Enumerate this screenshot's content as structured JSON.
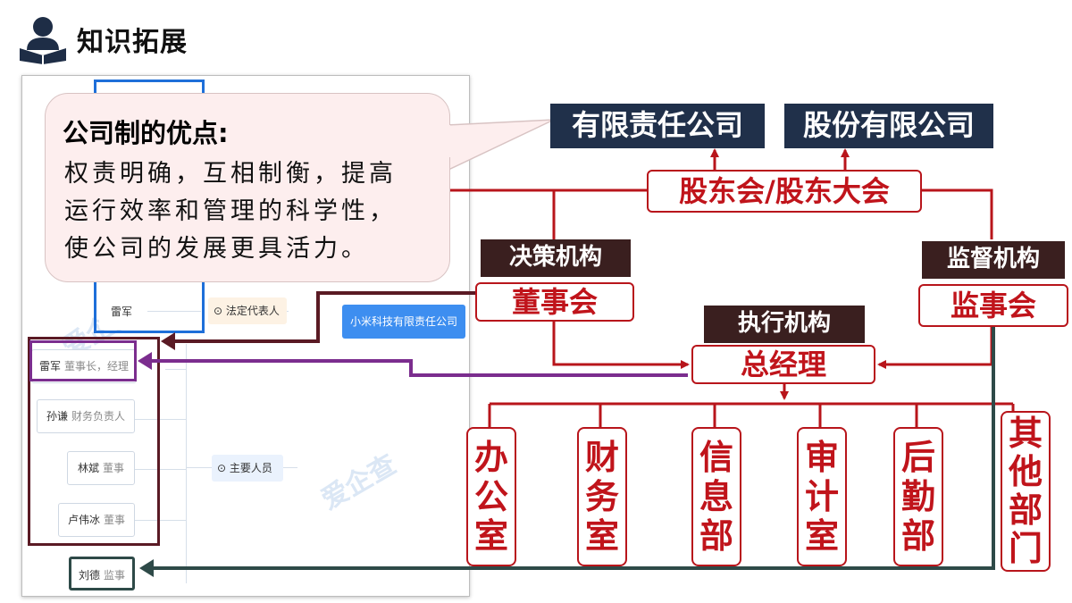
{
  "header": {
    "title": "知识拓展",
    "icon": "reader-book-icon"
  },
  "bubble": {
    "title": "公司制的优点:",
    "lines": [
      "权责明确，互相制衡，提高",
      "运行效率和管理的科学性，",
      "使公司的发展更具活力。"
    ]
  },
  "screenshot": {
    "watermark": "爱企查",
    "legal_rep_person": "雷军",
    "legal_rep_tag": "法定代表人",
    "company": "小米科技有限责任公司",
    "key_personnel_tag": "主要人员",
    "people": [
      {
        "name": "雷军",
        "role": "董事长，经理"
      },
      {
        "name": "孙谦",
        "role": "财务负责人"
      },
      {
        "name": "林斌",
        "role": "董事"
      },
      {
        "name": "卢伟冰",
        "role": "董事"
      },
      {
        "name": "刘德",
        "role": "监事"
      }
    ]
  },
  "org": {
    "company_types": [
      "有限责任公司",
      "股份有限公司"
    ],
    "shareholders": "股东会/股东大会",
    "decision_label": "决策机构",
    "board": "董事会",
    "supervision_label": "监督机构",
    "supervisory_board": "监事会",
    "execution_label": "执行机构",
    "general_manager": "总经理",
    "departments": [
      "办公室",
      "财务室",
      "信息部",
      "审计室",
      "后勤部",
      "其他部门"
    ]
  },
  "colors": {
    "navy": "#20304a",
    "red": "#b8151b",
    "dark_maroon": "#5a1a24",
    "purple": "#7b2d8e",
    "teal": "#2e4a48",
    "blue": "#1e6fd9"
  }
}
